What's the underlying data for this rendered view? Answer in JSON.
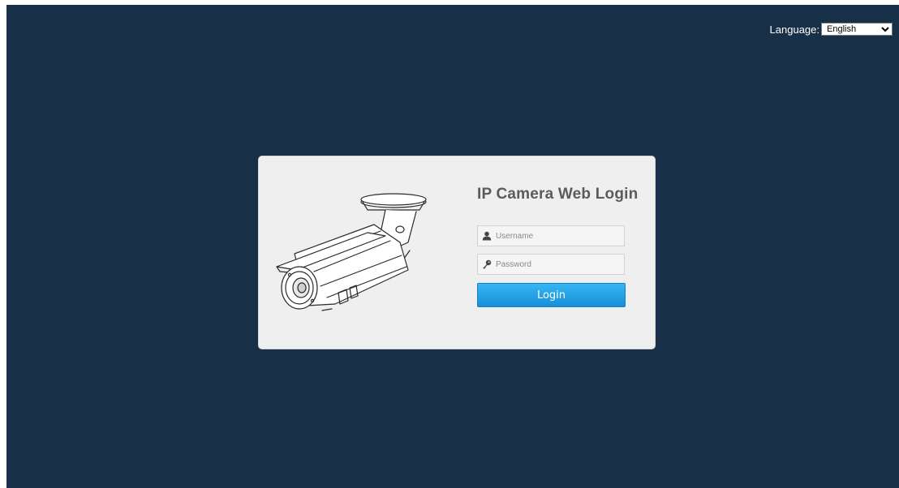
{
  "language": {
    "label": "Language:",
    "selected": "English"
  },
  "login": {
    "title": "IP Camera Web Login",
    "username_placeholder": "Username",
    "password_placeholder": "Password",
    "button_label": "Login"
  },
  "colors": {
    "background": "#173047",
    "card": "#efefef",
    "button": "#2aa6ea"
  },
  "icons": {
    "camera": "bullet-camera-illustration",
    "user": "user-icon",
    "key": "key-icon"
  }
}
